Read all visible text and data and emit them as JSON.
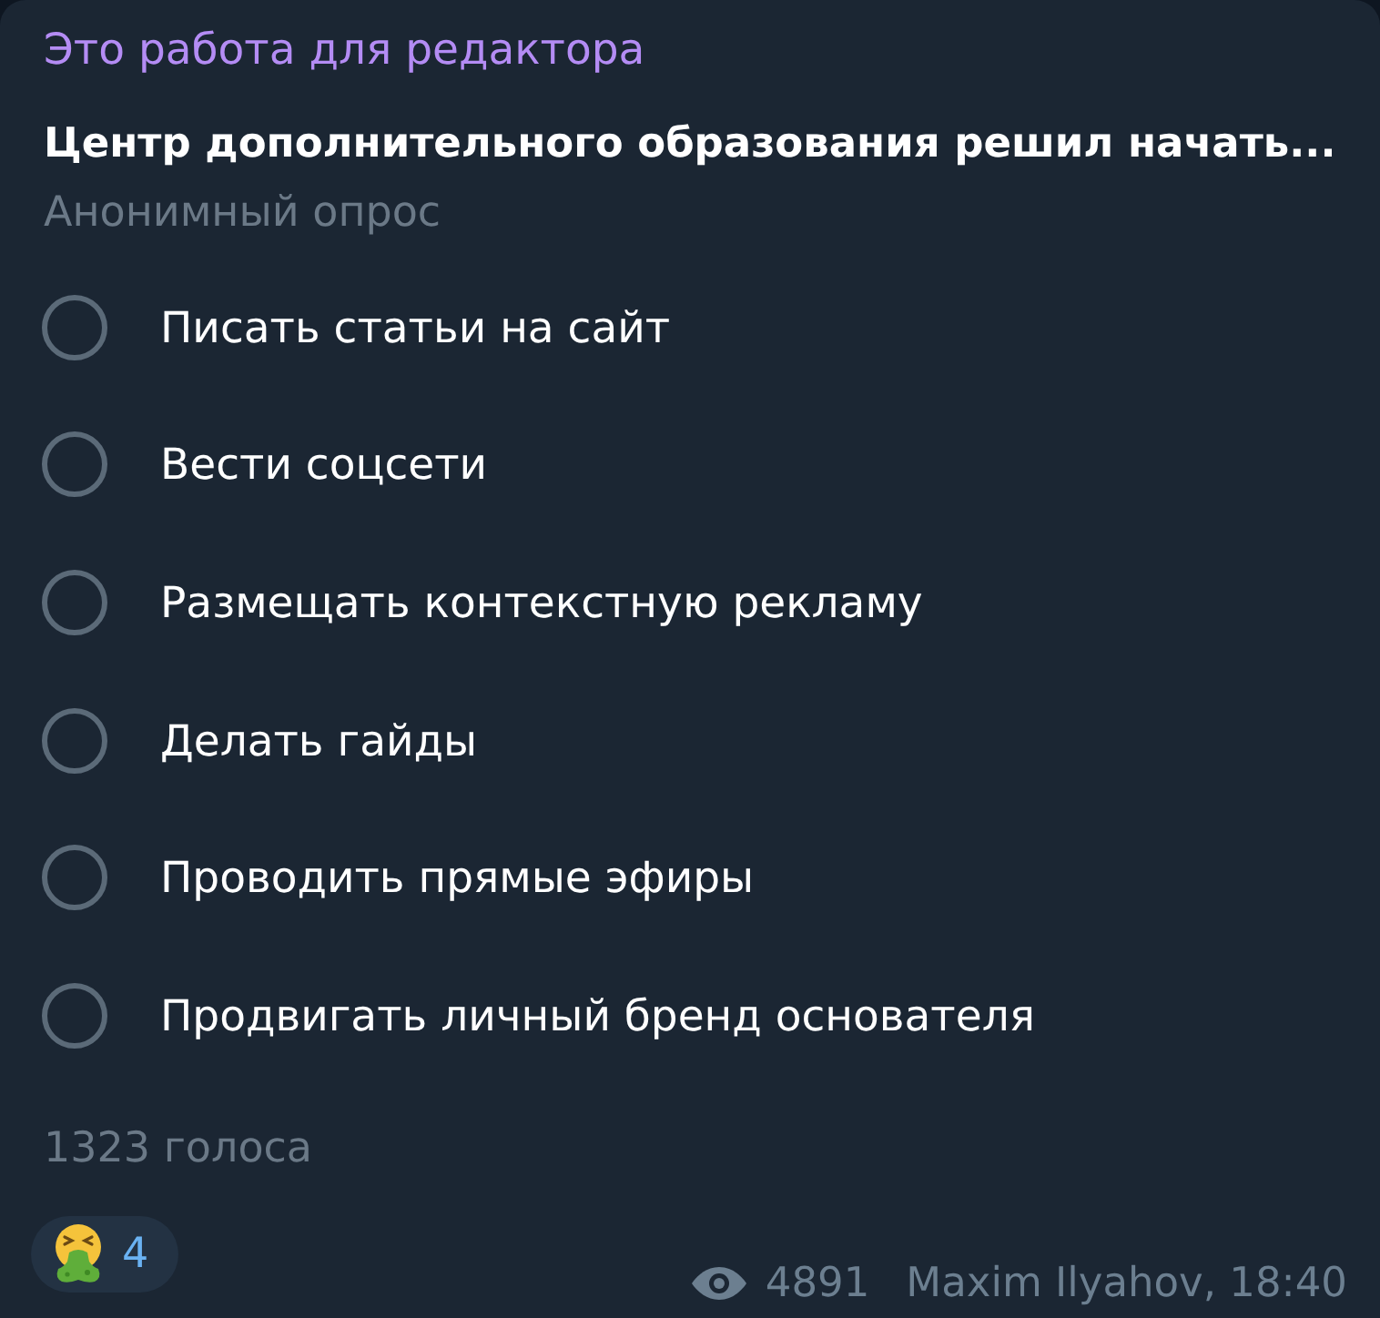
{
  "poll": {
    "title": "Это работа для редактора",
    "question": "Центр дополнительного образования решил начать...",
    "poll_type": "Анонимный опрос",
    "options": [
      {
        "label": "Писать статьи на сайт",
        "selected": false
      },
      {
        "label": "Вести соцсети",
        "selected": false
      },
      {
        "label": "Размещать контекстную рекламу",
        "selected": false
      },
      {
        "label": "Делать гайды",
        "selected": false
      },
      {
        "label": "Проводить прямые эфиры",
        "selected": false
      },
      {
        "label": "Продвигать личный бренд основателя",
        "selected": false
      }
    ],
    "votes": "1323 голоса"
  },
  "reaction": {
    "count": "4",
    "selected": false
  },
  "meta": {
    "views": "4891",
    "author_time": "Maxim Ilyahov, 18:40"
  }
}
